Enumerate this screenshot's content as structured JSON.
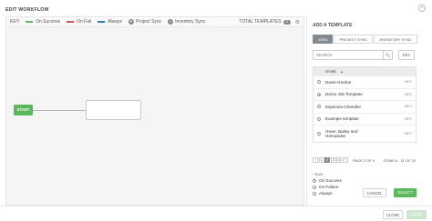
{
  "modal": {
    "title": "EDIT WORKFLOW",
    "close_symbol": "×"
  },
  "key": {
    "label": "KEY:",
    "items": [
      {
        "label": "On Success",
        "color": "#5cb85c"
      },
      {
        "label": "On Fail",
        "color": "#d9534f"
      },
      {
        "label": "Always",
        "color": "#337ab7"
      }
    ],
    "project_sync": {
      "badge": "P",
      "label": "Project Sync"
    },
    "inventory_sync": {
      "badge": "I",
      "label": "Inventory Sync"
    },
    "total_label": "TOTAL TEMPLATES",
    "total_count": "0"
  },
  "canvas": {
    "start_label": "START"
  },
  "panel": {
    "title": "ADD A TEMPLATE",
    "tabs": [
      "JOBS",
      "PROJECT SYNC",
      "INVENTORY SYNC"
    ],
    "search_placeholder": "SEARCH",
    "search_icon": "🔍",
    "key_button": "KEY",
    "list_header": "NAME",
    "sort_icon": "▲",
    "rows": [
      {
        "name": "Davis-Gordon",
        "info": "INFO",
        "checked": false
      },
      {
        "name": "Demo Job Template",
        "info": "INFO",
        "checked": true
      },
      {
        "name": "Espinoza-Chandler",
        "info": "INFO",
        "checked": false
      },
      {
        "name": "Example template",
        "info": "INFO",
        "checked": false
      },
      {
        "name": "Greer, Bailey and Hernandez",
        "info": "INFO",
        "checked": false
      }
    ],
    "pager": {
      "prev": "‹",
      "pages": [
        "1",
        "2",
        "3",
        "4"
      ],
      "next": "›",
      "page_of": "PAGE 2 OF 4"
    },
    "items_count": "ITEMS 6 - 11 OF 20",
    "run_label": "RUN",
    "run_required": "*",
    "run_options": [
      "On Success",
      "On Failure",
      "Always"
    ],
    "cancel": "CANCEL",
    "select": "SELECT"
  },
  "footer": {
    "close": "CLOSE",
    "save": "SAVE"
  },
  "colors": {
    "accent": "#848992",
    "success": "#5cb85c"
  }
}
